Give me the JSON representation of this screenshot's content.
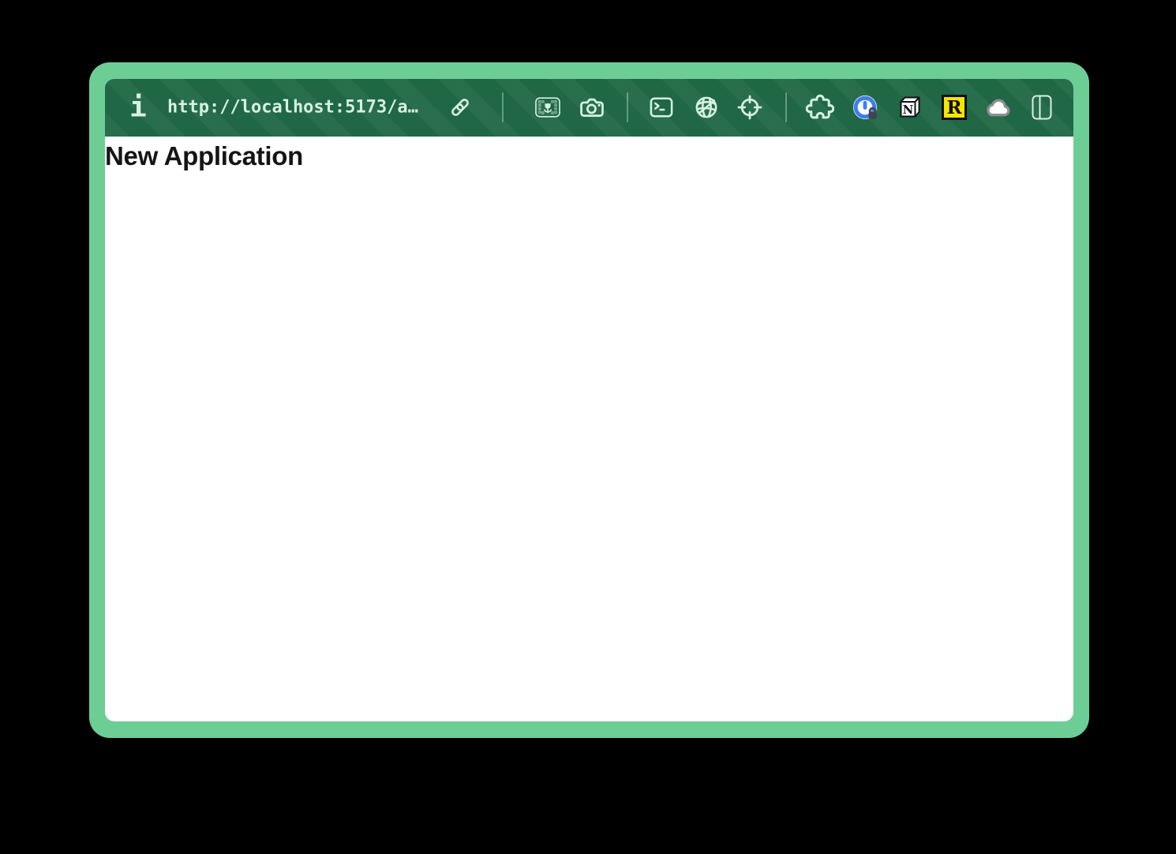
{
  "colors": {
    "frame_green": "#6dce95",
    "toolbar_green": "#1f6745",
    "icon_green": "#d6f2de",
    "content_bg": "#ffffff",
    "heading_color": "#151515",
    "onepassword_blue": "#3b7ef0",
    "lock_badge_gray": "#41454f",
    "r_badge_yellow": "#f6e500",
    "cloud_outline_gray": "#8b8e93",
    "notion_black": "#121212"
  },
  "toolbar": {
    "info_glyph": "i",
    "url_value": "http://localhost:5173/a…",
    "notion_letter": "N",
    "r_letter": "R",
    "icon_names": [
      "info-icon",
      "link-icon",
      "image-icon",
      "camera-icon",
      "terminal-icon",
      "globe-icon",
      "crosshair-icon",
      "extensions-puzzle-icon",
      "onepassword-icon",
      "notion-icon",
      "r-extension-icon",
      "cloud-icon",
      "split-view-icon"
    ]
  },
  "content": {
    "heading": "New Application"
  }
}
